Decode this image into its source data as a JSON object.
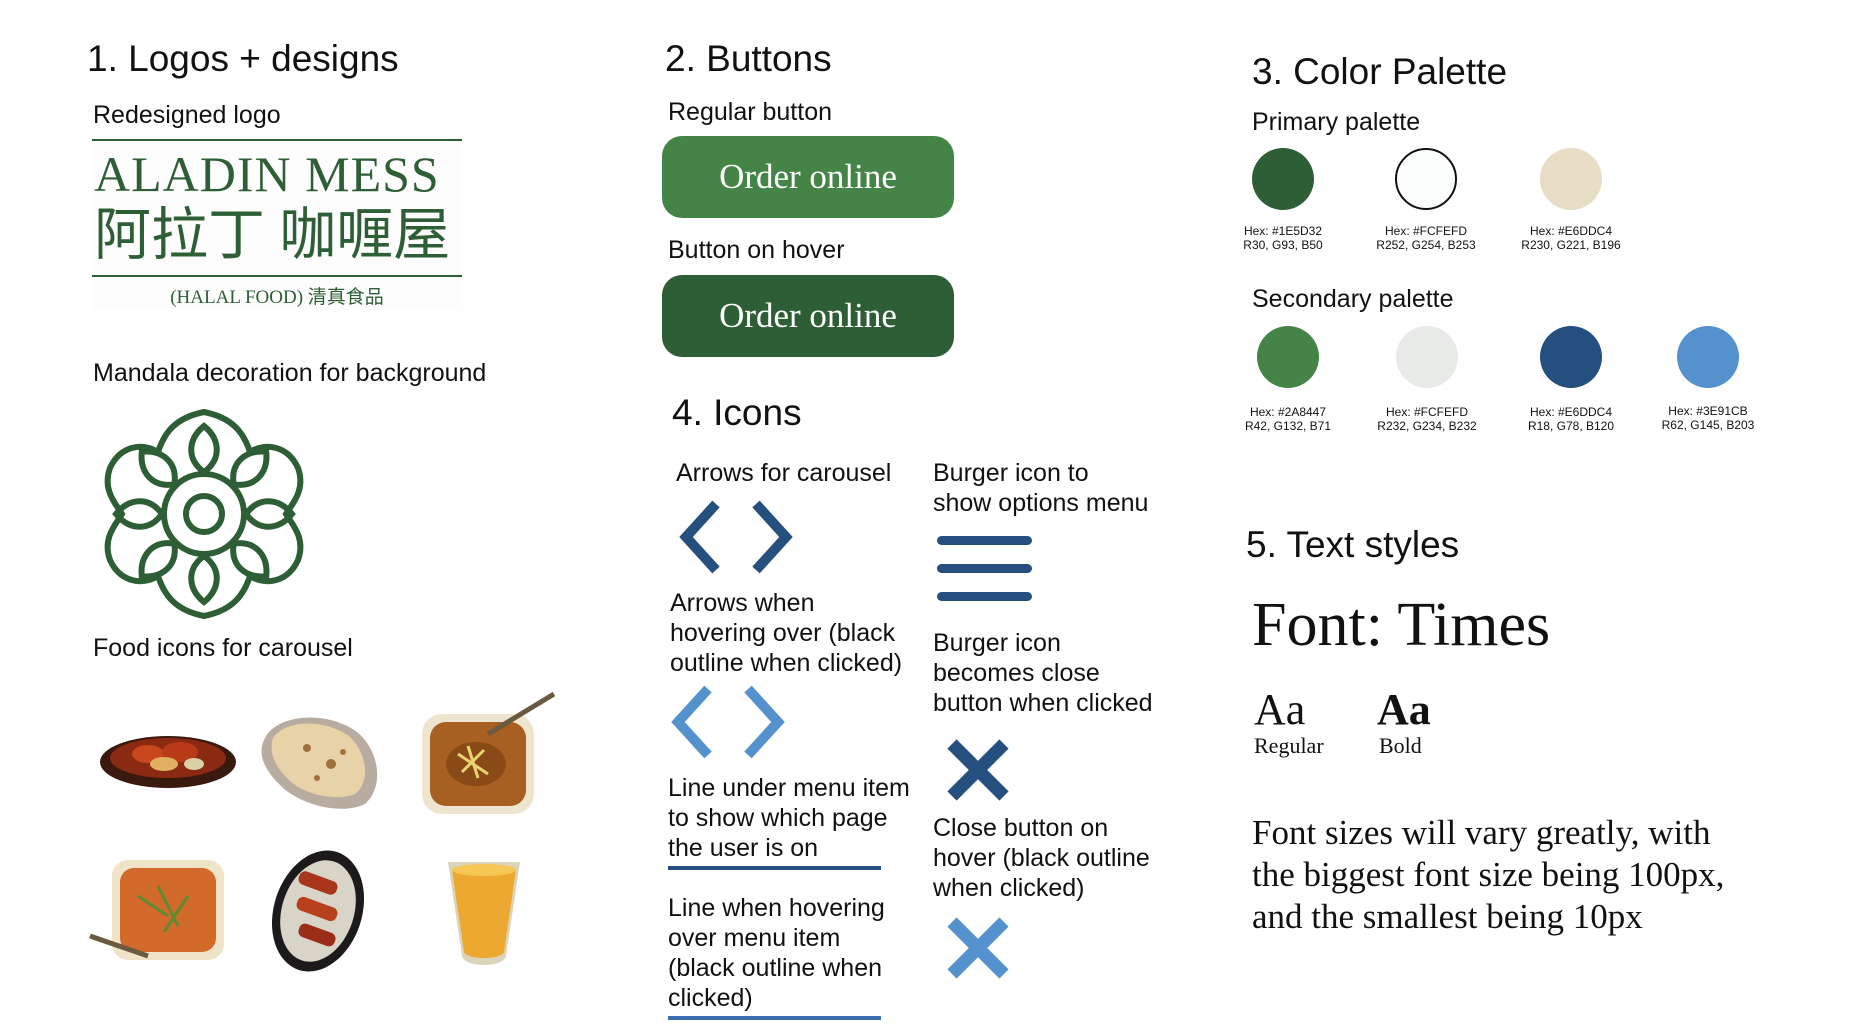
{
  "sections": {
    "logos": {
      "heading": "1. Logos + designs",
      "redesigned_logo_label": "Redesigned logo",
      "logo_line1": "ALADIN MESS",
      "logo_line2": "阿拉丁 咖喱屋",
      "logo_line3": "(HALAL FOOD) 清真食品",
      "mandala_label": "Mandala decoration for background",
      "food_icons_label": "Food icons for carousel"
    },
    "buttons": {
      "heading": "2. Buttons",
      "regular_label": "Regular button",
      "regular_text": "Order online",
      "hover_label": "Button on hover",
      "hover_text": "Order online"
    },
    "palette": {
      "heading": "3. Color Palette",
      "primary_label": "Primary palette",
      "primary": [
        {
          "hex": "Hex: #1E5D32",
          "rgb": "R30, G93, B50",
          "color": "#2e5e35"
        },
        {
          "hex": "Hex: #FCFEFD",
          "rgb": "R252, G254, B253",
          "color": "#fcfefd"
        },
        {
          "hex": "Hex: #E6DDC4",
          "rgb": "R230, G221, B196",
          "color": "#e6ddc4"
        }
      ],
      "secondary_label": "Secondary palette",
      "secondary": [
        {
          "hex": "Hex: #2A8447",
          "rgb": "R42, G132, B71",
          "color": "#448547"
        },
        {
          "hex": "Hex: #FCFEFD",
          "rgb": "R232, G234, B232",
          "color": "#e8eae8"
        },
        {
          "hex": "Hex: #E6DDC4",
          "rgb": "R18, G78, B120",
          "color": "#244f7e"
        },
        {
          "hex": "Hex: #3E91CB",
          "rgb": "R62, G145, B203",
          "color": "#5592cd"
        }
      ]
    },
    "icons": {
      "heading": "4. Icons",
      "arrows_label": "Arrows for carousel",
      "arrows_hover_label_1": "Arrows when",
      "arrows_hover_label_2": "hovering over (black",
      "arrows_hover_label_3": "outline when clicked)",
      "line_label_1": "Line under menu item",
      "line_label_2": "to show which page",
      "line_label_3": "the user is on",
      "line_hover_label_1": "Line when hovering",
      "line_hover_label_2": "over menu item",
      "line_hover_label_3": "(black outline when",
      "line_hover_label_4": "clicked)",
      "burger_label_1": "Burger icon to",
      "burger_label_2": "show options menu",
      "burger_close_label_1": "Burger icon",
      "burger_close_label_2": "becomes close",
      "burger_close_label_3": "button when clicked",
      "close_hover_label_1": "Close button on",
      "close_hover_label_2": "hover (black outline",
      "close_hover_label_3": "when clicked)"
    },
    "text_styles": {
      "heading": "5. Text styles",
      "font_title": "Font: Times",
      "regular_sample": "Aa",
      "regular_caption": "Regular",
      "bold_sample": "Aa",
      "bold_caption": "Bold",
      "note_line1": "Font sizes will vary greatly, with",
      "note_line2": "the biggest font size being 100px,",
      "note_line3": "and the smallest being 10px"
    }
  },
  "colors": {
    "brand_green": "#2e5e35",
    "button_regular": "#448547",
    "button_hover": "#2e5e35",
    "icon_dark_blue": "#244f7e",
    "icon_light_blue": "#5592cd",
    "line_blue": "#3a6fb0"
  }
}
